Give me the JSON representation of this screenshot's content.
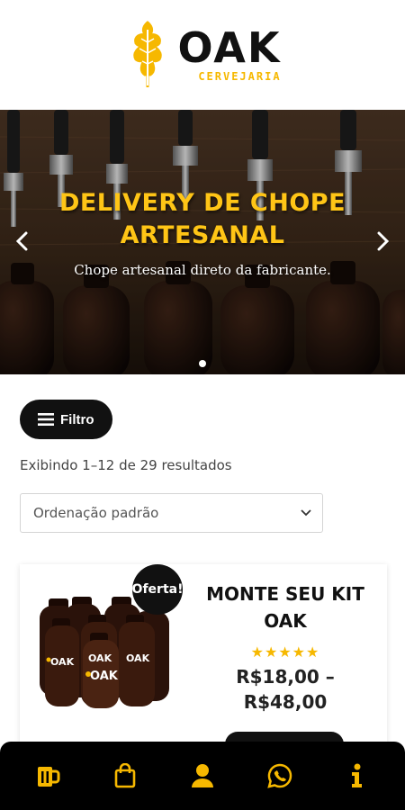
{
  "brand": {
    "name": "OAK",
    "subtitle": "CERVEJARIA",
    "accent_color": "#f6b800"
  },
  "hero": {
    "title_line1": "DELIVERY DE CHOPE",
    "title_line2": "ARTESANAL",
    "subtitle": "Chope artesanal direto da fabricante.",
    "prev_icon": "chevron-left-icon",
    "next_icon": "chevron-right-icon",
    "slides_total": 1,
    "active_slide": 1
  },
  "filter": {
    "label": "Filtro",
    "icon": "menu-icon"
  },
  "results": {
    "text": "Exibindo 1–12 de 29 resultados"
  },
  "sort": {
    "selected": "Ordenação padrão"
  },
  "product": {
    "badge": "Oferta!",
    "title_line1": "MONTE SEU KIT",
    "title_line2": "OAK",
    "rating": 5,
    "rating_max": 5,
    "price_line1": "R$18,00 –",
    "price_line2": "R$48,00"
  },
  "bottom_nav": {
    "items": [
      {
        "icon": "beer-mug-icon"
      },
      {
        "icon": "shopping-bag-icon"
      },
      {
        "icon": "user-icon"
      },
      {
        "icon": "whatsapp-icon"
      },
      {
        "icon": "info-icon"
      }
    ],
    "icon_color": "#f6b800"
  }
}
